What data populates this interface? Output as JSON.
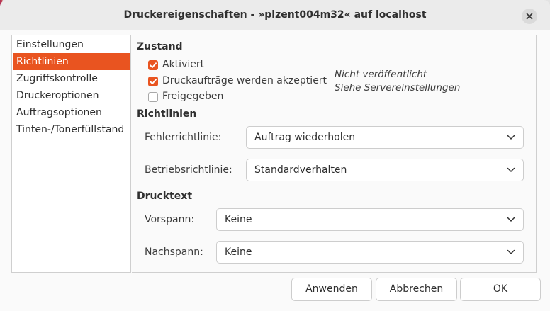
{
  "window": {
    "title": "Druckereigenschaften - »plzent004m32« auf localhost"
  },
  "sidebar": {
    "items": [
      {
        "label": "Einstellungen",
        "selected": false
      },
      {
        "label": "Richtlinien",
        "selected": true
      },
      {
        "label": "Zugriffskontrolle",
        "selected": false
      },
      {
        "label": "Druckeroptionen",
        "selected": false
      },
      {
        "label": "Auftragsoptionen",
        "selected": false
      },
      {
        "label": "Tinten-/Tonerfüllstand",
        "selected": false
      }
    ]
  },
  "state": {
    "heading": "Zustand",
    "checkboxes": [
      {
        "label": "Aktiviert",
        "checked": true
      },
      {
        "label": "Druckaufträge werden akzeptiert",
        "checked": true
      },
      {
        "label": "Freigegeben",
        "checked": false
      }
    ],
    "note_line1": "Nicht veröffentlicht",
    "note_line2": "Siehe Servereinstellungen"
  },
  "policies": {
    "heading": "Richtlinien",
    "error_policy_label": "Fehlerrichtlinie:",
    "error_policy_value": "Auftrag wiederholen",
    "operation_policy_label": "Betriebsrichtlinie:",
    "operation_policy_value": "Standardverhalten"
  },
  "banner": {
    "heading": "Drucktext",
    "start_label": "Vorspann:",
    "start_value": "Keine",
    "end_label": "Nachspann:",
    "end_value": "Keine"
  },
  "buttons": {
    "apply": "Anwenden",
    "cancel": "Abbrechen",
    "ok": "OK"
  },
  "colors": {
    "accent": "#e95420",
    "selected_text": "#ffffff"
  }
}
